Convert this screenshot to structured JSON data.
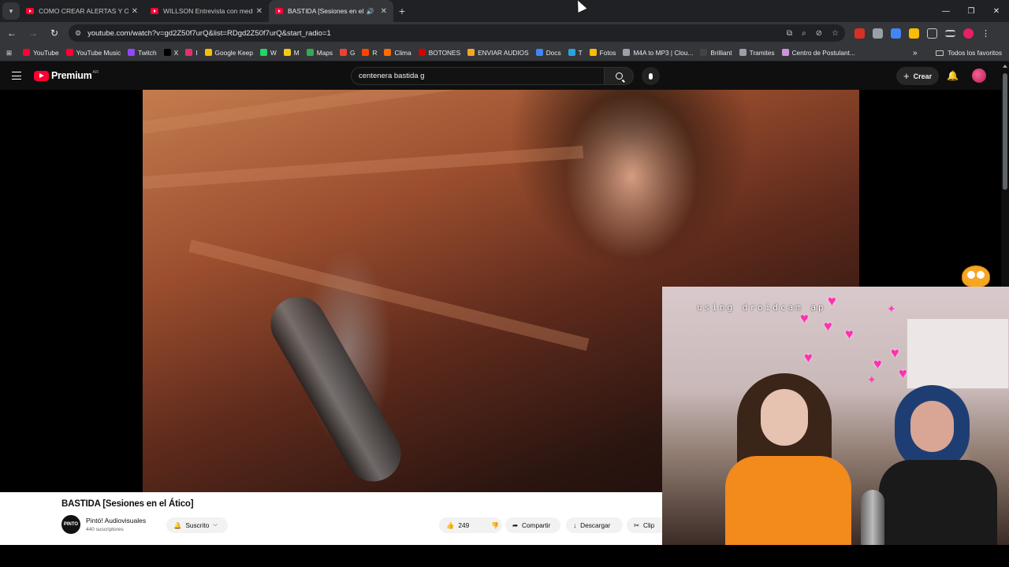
{
  "browser": {
    "tabs": [
      {
        "title": "COMO CREAR ALERTAS Y OVE",
        "active": false
      },
      {
        "title": "WILLSON Entrevista con medio",
        "active": false
      },
      {
        "title": "BASTIDA [Sesiones en el Áti",
        "active": true
      }
    ],
    "url": "youtube.com/watch?v=gd2Z50f7urQ&list=RDgd2Z50f7urQ&start_radio=1",
    "bookmarks": [
      {
        "label": "YouTube",
        "color": "#ff0033"
      },
      {
        "label": "YouTube Music",
        "color": "#ff0033"
      },
      {
        "label": "Twitch",
        "color": "#9146ff"
      },
      {
        "label": "X",
        "color": "#000000"
      },
      {
        "label": "I",
        "color": "#e1306c"
      },
      {
        "label": "Google Keep",
        "color": "#fbbc04"
      },
      {
        "label": "W",
        "color": "#25d366"
      },
      {
        "label": "M",
        "color": "#f6c915"
      },
      {
        "label": "Maps",
        "color": "#34a853"
      },
      {
        "label": "G",
        "color": "#ea4335"
      },
      {
        "label": "R",
        "color": "#ff4500"
      },
      {
        "label": "Clima",
        "color": "#ff6d00"
      },
      {
        "label": "BOTONES",
        "color": "#d50000"
      },
      {
        "label": "ENVIAR AUDIOS",
        "color": "#f5a623"
      },
      {
        "label": "Docs",
        "color": "#4285f4"
      },
      {
        "label": "T",
        "color": "#2aa3df"
      },
      {
        "label": "Fotos",
        "color": "#fbbc04"
      },
      {
        "label": "M4A to MP3 | Clou...",
        "color": "#9aa0a6"
      },
      {
        "label": "Brilliant",
        "color": "#444444"
      },
      {
        "label": "Tramites",
        "color": "#9aa0a6"
      },
      {
        "label": "Centro de Postulant...",
        "color": "#ce93d8"
      }
    ],
    "all_bookmarks": "Todos los favoritos"
  },
  "youtube": {
    "logo": "Premium",
    "country": "AR",
    "search_value": "centenera bastida g",
    "create_label": "Crear",
    "video": {
      "title": "BASTIDA [Sesiones en el Ático]",
      "channel": "Pintó! Audiovisuales",
      "channel_avatar": "PINTO",
      "subscribers": "440 suscriptores",
      "subscribed_label": "Suscrito",
      "likes": "249",
      "share_label": "Compartir",
      "download_label": "Descargar",
      "clip_label": "Clip"
    }
  },
  "webcam": {
    "watermark": "using droidcam ap"
  }
}
